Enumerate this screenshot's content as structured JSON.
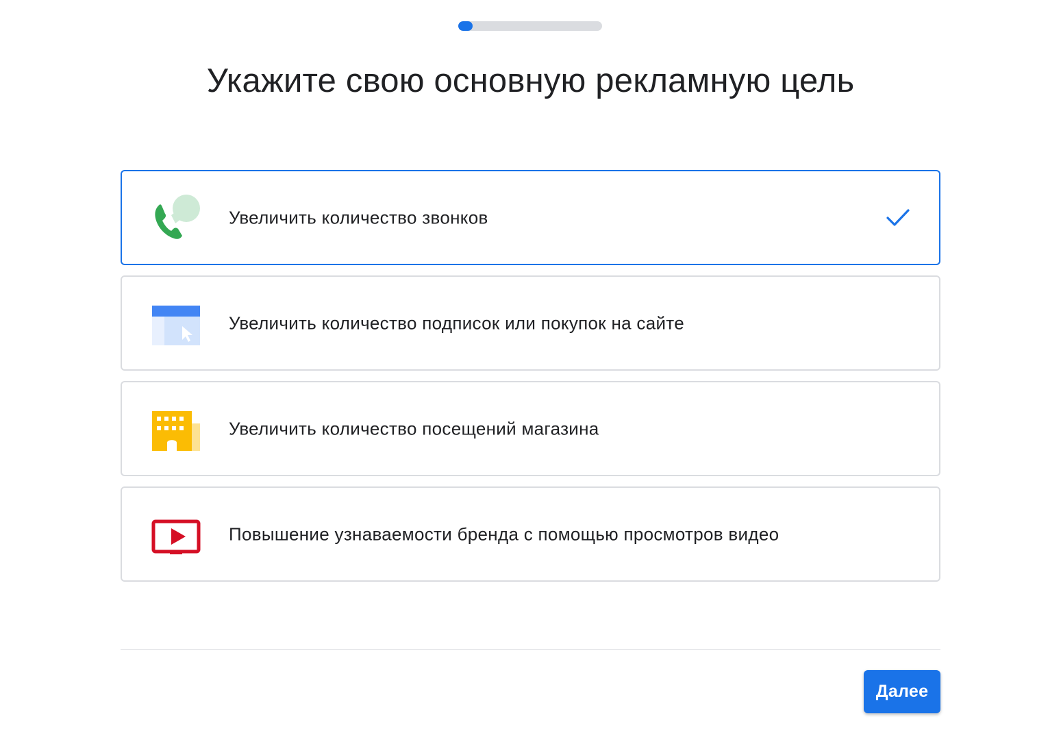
{
  "progress": {
    "step_fraction": 0.1,
    "fill_color": "#1a73e8",
    "track_color": "#dadce0"
  },
  "header": {
    "title": "Укажите свою основную рекламную цель"
  },
  "goals": [
    {
      "label": "Увеличить количество звонков",
      "icon": "phone-call-icon",
      "selected": true
    },
    {
      "label": "Увеличить количество подписок или покупок на сайте",
      "icon": "website-click-icon",
      "selected": false
    },
    {
      "label": "Увеличить количество посещений магазина",
      "icon": "store-icon",
      "selected": false
    },
    {
      "label": "Повышение узнаваемости бренда с помощью просмотров видео",
      "icon": "video-play-icon",
      "selected": false
    }
  ],
  "footer": {
    "next_label": "Далее"
  },
  "colors": {
    "accent": "#1a73e8",
    "card_border": "#dadce0",
    "text": "#202124"
  }
}
